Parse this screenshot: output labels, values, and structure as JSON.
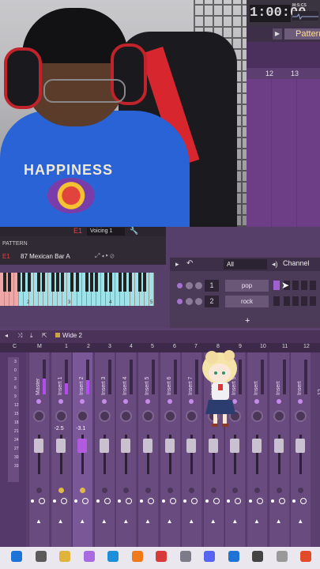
{
  "clock": {
    "time": "1:00:00",
    "label": "M:S:CS"
  },
  "playlist": {
    "pattern_label": "Pattern",
    "ruler": [
      "12",
      "13"
    ]
  },
  "vst": {
    "code": "E1",
    "voicing": "Voicing 1",
    "pattern_title": "PATTERN",
    "pattern_code": "E1",
    "pattern_name": "87  Mexican Bar A",
    "octave_labels": [
      "2",
      "3",
      "4",
      "5"
    ]
  },
  "channel_rack": {
    "filter": "All",
    "title": "Channel",
    "rows": [
      {
        "num": "1",
        "name": "pop"
      },
      {
        "num": "2",
        "name": "rock"
      }
    ],
    "add": "+"
  },
  "mixer": {
    "preset": "Wide 2",
    "columns": [
      "C",
      "M",
      "1",
      "2",
      "3",
      "4",
      "5",
      "6",
      "7",
      "8",
      "9",
      "10",
      "11",
      "12"
    ],
    "tracks": [
      {
        "name": "Master",
        "db": "",
        "selected": false
      },
      {
        "name": "Insert 1",
        "db": "-2.5",
        "selected": false
      },
      {
        "name": "Insert 2",
        "db": "-3.1",
        "selected": true
      },
      {
        "name": "Insert 3",
        "db": "",
        "selected": false
      },
      {
        "name": "Insert 4",
        "db": "",
        "selected": false
      },
      {
        "name": "Insert 5",
        "db": "",
        "selected": false
      },
      {
        "name": "Insert 6",
        "db": "",
        "selected": false
      },
      {
        "name": "Insert 7",
        "db": "",
        "selected": false
      },
      {
        "name": "Insert 8",
        "db": "",
        "selected": false
      },
      {
        "name": "Insert 9",
        "db": "",
        "selected": false
      },
      {
        "name": "Insert 10",
        "db": "",
        "selected": false
      },
      {
        "name": "Insert 11",
        "db": "",
        "selected": false
      },
      {
        "name": "Insert 12",
        "db": "",
        "selected": false
      }
    ],
    "meter_ticks": [
      "3",
      "0",
      "3",
      "6",
      "9",
      "12",
      "15",
      "18",
      "21",
      "24",
      "27",
      "30",
      "33"
    ]
  },
  "webcam": {
    "shirt_text": "HAPPINESS"
  },
  "taskbar": {
    "icons": [
      "windows-icon",
      "file-explorer-icon",
      "folder-icon",
      "copilot-icon",
      "edge-icon",
      "fl-studio-icon",
      "opera-icon",
      "settings-icon",
      "discord-icon",
      "store-icon",
      "obs-icon",
      "notes-icon",
      "ea-icon"
    ]
  }
}
